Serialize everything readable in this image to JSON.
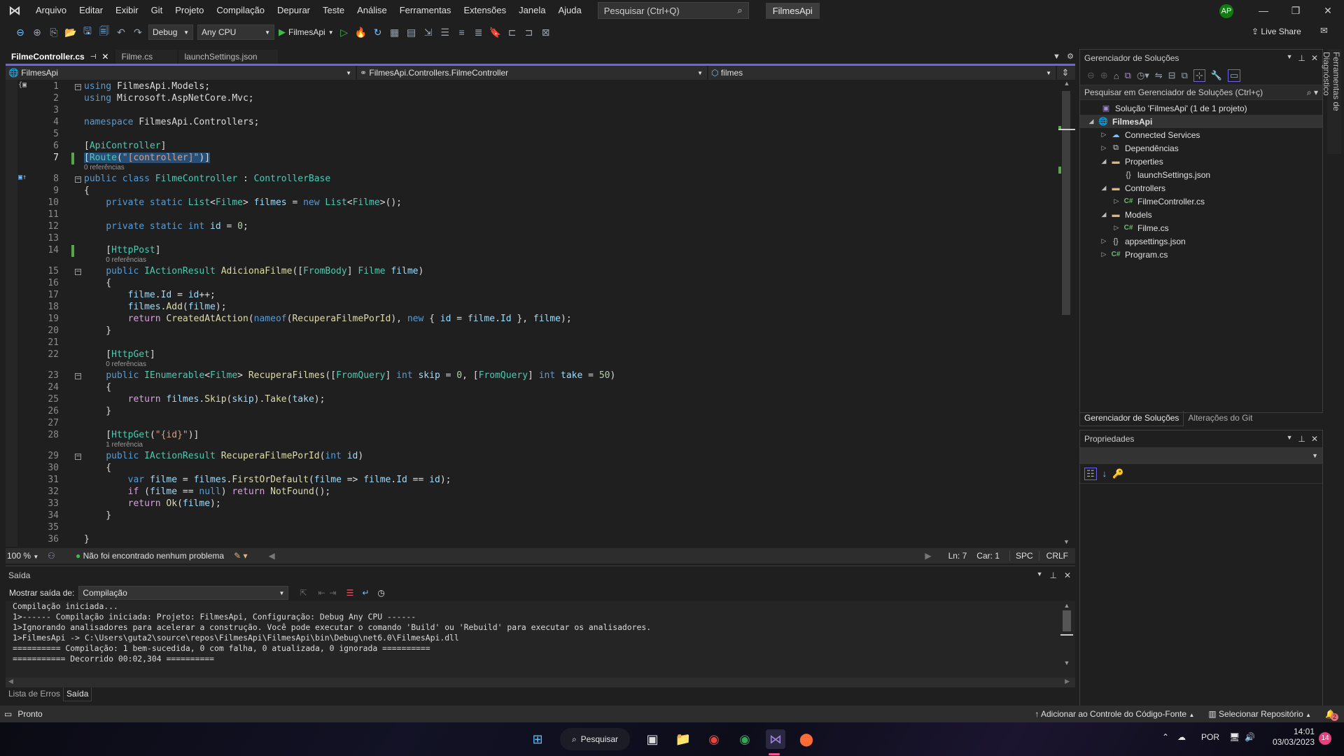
{
  "titlebar": {
    "menu": [
      "Arquivo",
      "Editar",
      "Exibir",
      "Git",
      "Projeto",
      "Compilação",
      "Depurar",
      "Teste",
      "Análise",
      "Ferramentas",
      "Extensões",
      "Janela",
      "Ajuda"
    ],
    "search_placeholder": "Pesquisar (Ctrl+Q)",
    "solution_name": "FilmesApi",
    "avatar_initials": "AP"
  },
  "toolbar": {
    "configuration": "Debug",
    "platform": "Any CPU",
    "run_target": "FilmesApi",
    "live_share": "Live Share"
  },
  "editor": {
    "tabs": [
      {
        "label": "FilmeController.cs",
        "active": true
      },
      {
        "label": "Filme.cs",
        "active": false
      },
      {
        "label": "launchSettings.json",
        "active": false
      }
    ],
    "nav": {
      "project": "FilmesApi",
      "type": "FilmesApi.Controllers.FilmeController",
      "member": "filmes"
    },
    "lines": [
      {
        "n": "1",
        "html": "<span class='kw'>using</span> FilmesApi.Models;"
      },
      {
        "n": "2",
        "html": "<span class='kw'>using</span> Microsoft.AspNetCore.Mvc;"
      },
      {
        "n": "3",
        "html": ""
      },
      {
        "n": "4",
        "html": "<span class='kw'>namespace</span> FilmesApi.Controllers;"
      },
      {
        "n": "5",
        "html": ""
      },
      {
        "n": "6",
        "html": "[<span class='ty'>ApiController</span>]"
      },
      {
        "n": "7",
        "html": "<span class='sel'>[<span class='ty'>Route</span>(<span class='str'>\"[controller]\"</span>)]</span>",
        "ref": "0 referências"
      },
      {
        "n": "8",
        "html": "<span class='kw'>public class</span> <span class='ty'>FilmeController</span> : <span class='ty'>ControllerBase</span>"
      },
      {
        "n": "9",
        "html": "{"
      },
      {
        "n": "10",
        "html": "    <span class='kw'>private static</span> <span class='ty'>List</span>&lt;<span class='ty'>Filme</span>&gt; <span class='id'>filmes</span> = <span class='kw'>new</span> <span class='ty'>List</span>&lt;<span class='ty'>Filme</span>&gt;();"
      },
      {
        "n": "11",
        "html": ""
      },
      {
        "n": "12",
        "html": "    <span class='kw'>private static int</span> <span class='id'>id</span> = <span class='num'>0</span>;"
      },
      {
        "n": "13",
        "html": ""
      },
      {
        "n": "14",
        "html": "    [<span class='ty'>HttpPost</span>]",
        "ref": "0 referências"
      },
      {
        "n": "15",
        "html": "    <span class='kw'>public</span> <span class='ty'>IActionResult</span> <span class='fn'>AdicionaFilme</span>([<span class='ty'>FromBody</span>] <span class='ty'>Filme</span> <span class='id'>filme</span>)"
      },
      {
        "n": "16",
        "html": "    {"
      },
      {
        "n": "17",
        "html": "        <span class='id'>filme</span>.<span class='id'>Id</span> = <span class='id'>id</span>++;"
      },
      {
        "n": "18",
        "html": "        <span class='id'>filmes</span>.<span class='fn'>Add</span>(<span class='id'>filme</span>);"
      },
      {
        "n": "19",
        "html": "        <span class='ctl'>return</span> <span class='fn'>CreatedAtAction</span>(<span class='kw'>nameof</span>(<span class='fn'>RecuperaFilmePorId</span>), <span class='kw'>new</span> { <span class='id'>id</span> = <span class='id'>filme</span>.<span class='id'>Id</span> }, <span class='id'>filme</span>);"
      },
      {
        "n": "20",
        "html": "    }"
      },
      {
        "n": "21",
        "html": ""
      },
      {
        "n": "22",
        "html": "    [<span class='ty'>HttpGet</span>]",
        "ref": "0 referências"
      },
      {
        "n": "23",
        "html": "    <span class='kw'>public</span> <span class='ty'>IEnumerable</span>&lt;<span class='ty'>Filme</span>&gt; <span class='fn'>RecuperaFilmes</span>([<span class='ty'>FromQuery</span>] <span class='kw'>int</span> <span class='id'>skip</span> = <span class='num'>0</span>, [<span class='ty'>FromQuery</span>] <span class='kw'>int</span> <span class='id'>take</span> = <span class='num'>50</span>)"
      },
      {
        "n": "24",
        "html": "    {"
      },
      {
        "n": "25",
        "html": "        <span class='ctl'>return</span> <span class='id'>filmes</span>.<span class='fn'>Skip</span>(<span class='id'>skip</span>).<span class='fn'>Take</span>(<span class='id'>take</span>);"
      },
      {
        "n": "26",
        "html": "    }"
      },
      {
        "n": "27",
        "html": ""
      },
      {
        "n": "28",
        "html": "    [<span class='ty'>HttpGet</span>(<span class='str'>\"{id}\"</span>)]",
        "ref": "1 referência"
      },
      {
        "n": "29",
        "html": "    <span class='kw'>public</span> <span class='ty'>IActionResult</span> <span class='fn'>RecuperaFilmePorId</span>(<span class='kw'>int</span> <span class='id'>id</span>)"
      },
      {
        "n": "30",
        "html": "    {"
      },
      {
        "n": "31",
        "html": "        <span class='kw'>var</span> <span class='id'>filme</span> = <span class='id'>filmes</span>.<span class='fn'>FirstOrDefault</span>(<span class='id'>filme</span> =&gt; <span class='id'>filme</span>.<span class='id'>Id</span> == <span class='id'>id</span>);"
      },
      {
        "n": "32",
        "html": "        <span class='ctl'>if</span> (<span class='id'>filme</span> == <span class='kw'>null</span>) <span class='ctl'>return</span> <span class='fn'>NotFound</span>();"
      },
      {
        "n": "33",
        "html": "        <span class='ctl'>return</span> <span class='fn'>Ok</span>(<span class='id'>filme</span>);"
      },
      {
        "n": "34",
        "html": "    }"
      },
      {
        "n": "35",
        "html": ""
      },
      {
        "n": "36",
        "html": "}"
      }
    ],
    "current_line": "7",
    "status": {
      "zoom": "100 %",
      "problems": "Não foi encontrado nenhum problema",
      "line": "Ln: 7",
      "col": "Car: 1",
      "indent": "SPC",
      "eol": "CRLF"
    }
  },
  "output": {
    "title": "Saída",
    "show_from_label": "Mostrar saída de:",
    "source": "Compilação",
    "lines": [
      "Compilação iniciada...",
      "1>------ Compilação iniciada: Projeto: FilmesApi, Configuração: Debug Any CPU ------",
      "1>Ignorando analisadores para acelerar a construção. Você pode executar o comando 'Build' ou 'Rebuild' para executar os analisadores.",
      "1>FilmesApi -> C:\\Users\\guta2\\source\\repos\\FilmesApi\\FilmesApi\\bin\\Debug\\net6.0\\FilmesApi.dll",
      "========== Compilação: 1 bem-sucedida, 0 com falha, 0 atualizada, 0 ignorada ==========",
      "=========== Decorrido 00:02,304 =========="
    ],
    "bottom_tabs": [
      {
        "label": "Lista de Erros",
        "active": false
      },
      {
        "label": "Saída",
        "active": true
      }
    ]
  },
  "solution_explorer": {
    "title": "Gerenciador de Soluções",
    "search_placeholder": "Pesquisar em Gerenciador de Soluções (Ctrl+ç)",
    "tree": [
      {
        "label": "Solução 'FilmesApi' (1 de 1 projeto)",
        "depth": 0,
        "twisty": "",
        "icon": "solution-icon",
        "glyph": "▣",
        "bold": false
      },
      {
        "label": "FilmesApi",
        "depth": 0,
        "twisty": "◢",
        "icon": "project-icon",
        "glyph": "🌐",
        "bold": true,
        "selected": true
      },
      {
        "label": "Connected Services",
        "depth": 1,
        "twisty": "▷",
        "icon": "connected-services-icon",
        "glyph": "☁"
      },
      {
        "label": "Dependências",
        "depth": 1,
        "twisty": "▷",
        "icon": "dependencies-icon",
        "glyph": "⧉"
      },
      {
        "label": "Properties",
        "depth": 1,
        "twisty": "◢",
        "icon": "properties-folder-icon",
        "glyph": "▬"
      },
      {
        "label": "launchSettings.json",
        "depth": 2,
        "twisty": "",
        "icon": "json-file-icon",
        "glyph": "{}"
      },
      {
        "label": "Controllers",
        "depth": 1,
        "twisty": "◢",
        "icon": "folder-icon",
        "glyph": "▬"
      },
      {
        "label": "FilmeController.cs",
        "depth": 2,
        "twisty": "▷",
        "icon": "csharp-file-icon",
        "glyph": "C#"
      },
      {
        "label": "Models",
        "depth": 1,
        "twisty": "◢",
        "icon": "folder-icon",
        "glyph": "▬"
      },
      {
        "label": "Filme.cs",
        "depth": 2,
        "twisty": "▷",
        "icon": "csharp-file-icon",
        "glyph": "C#"
      },
      {
        "label": "appsettings.json",
        "depth": 1,
        "twisty": "▷",
        "icon": "json-file-icon",
        "glyph": "{}"
      },
      {
        "label": "Program.cs",
        "depth": 1,
        "twisty": "▷",
        "icon": "csharp-file-icon",
        "glyph": "C#"
      }
    ],
    "tabs": [
      {
        "label": "Gerenciador de Soluções",
        "active": true
      },
      {
        "label": "Alterações do Git",
        "active": false
      }
    ]
  },
  "properties": {
    "title": "Propriedades"
  },
  "diagnostic_tools_tab": "Ferramentas de Diagnóstico",
  "statusbar": {
    "ready": "Pronto",
    "source_control": "Adicionar ao Controle do Código-Fonte",
    "select_repo": "Selecionar Repositório",
    "notifications": "2"
  },
  "taskbar": {
    "search_label": "Pesquisar",
    "language": "POR",
    "time": "14:01",
    "date": "03/03/2023",
    "notification_count": "14"
  },
  "colors": {
    "accent": "#7160e8",
    "vs_purple": "#8661c5",
    "change_bar": "#57a64a",
    "avatar": "#107c10"
  }
}
